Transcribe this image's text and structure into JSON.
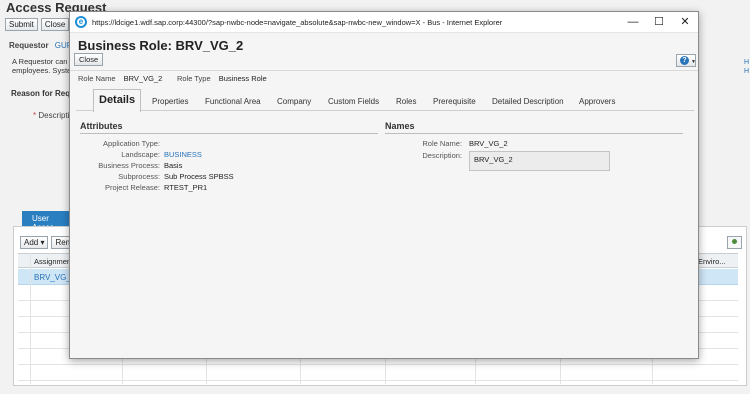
{
  "background": {
    "page_title": "Access Request",
    "toolbar": {
      "submit_label": "Submit",
      "close_label": "Close"
    },
    "requestor": {
      "label": "Requestor",
      "value": "GUPT"
    },
    "info_lines": [
      "A Requestor can",
      "employees. Syste"
    ],
    "reason_label": "Reason for Requ",
    "description_label": "Descripti",
    "right_links": [
      "H",
      "H"
    ],
    "tab_label": "User Acces",
    "table_toolbar": {
      "add_label": "Add",
      "remove_label": "Rem"
    },
    "table": {
      "columns": [
        "Assignmen",
        "Enviro..."
      ],
      "rows": [
        [
          "BRV_VG_"
        ]
      ]
    }
  },
  "modal": {
    "window": {
      "url": "https://ldcige1.wdf.sap.corp:44300/?sap-nwbc-node=navigate_absolute&sap-nwbc-new_window=X - Bus - Internet Explorer",
      "minimize": "—",
      "maximize": "☐",
      "close": "✕"
    },
    "title": "Business Role: BRV_VG_2",
    "close_button": "Close",
    "help_icon": "question-icon",
    "role_name_label": "Role Name",
    "role_name_value": "BRV_VG_2",
    "role_type_label": "Role Type",
    "role_type_value": "Business Role",
    "tabs": [
      "Details",
      "Properties",
      "Functional Area",
      "Company",
      "Custom Fields",
      "Roles",
      "Prerequisite",
      "Detailed Description",
      "Approvers"
    ],
    "active_tab": "Details",
    "attributes": {
      "title": "Attributes",
      "fields": [
        {
          "label": "Application Type:",
          "value": ""
        },
        {
          "label": "Landscape:",
          "value": "BUSINESS"
        },
        {
          "label": "Business Process:",
          "value": "Basis"
        },
        {
          "label": "Subprocess:",
          "value": "Sub Process SPBSS"
        },
        {
          "label": "Project Release:",
          "value": "RTEST_PR1"
        }
      ]
    },
    "names": {
      "title": "Names",
      "role_name_label": "Role Name:",
      "role_name_value": "BRV_VG_2",
      "description_label": "Description:",
      "description_value": "BRV_VG_2"
    }
  }
}
